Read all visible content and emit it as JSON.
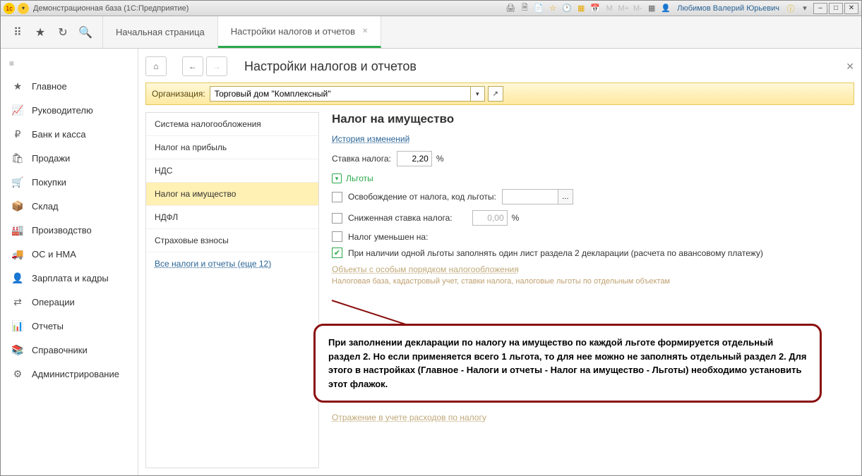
{
  "titlebar": {
    "title": "Демонстрационная база  (1С:Предприятие)",
    "user": "Любимов Валерий Юрьевич",
    "m_buttons": [
      "M",
      "M+",
      "M-"
    ]
  },
  "tabs": {
    "home": "Начальная страница",
    "active": "Настройки налогов и отчетов"
  },
  "sidebar": [
    {
      "icon": "★",
      "label": "Главное"
    },
    {
      "icon": "📈",
      "label": "Руководителю"
    },
    {
      "icon": "₽",
      "label": "Банк и касса"
    },
    {
      "icon": "🛍",
      "label": "Продажи"
    },
    {
      "icon": "🛒",
      "label": "Покупки"
    },
    {
      "icon": "📦",
      "label": "Склад"
    },
    {
      "icon": "🏭",
      "label": "Производство"
    },
    {
      "icon": "🚚",
      "label": "ОС и НМА"
    },
    {
      "icon": "👤",
      "label": "Зарплата и кадры"
    },
    {
      "icon": "⇄",
      "label": "Операции"
    },
    {
      "icon": "📊",
      "label": "Отчеты"
    },
    {
      "icon": "📚",
      "label": "Справочники"
    },
    {
      "icon": "⚙",
      "label": "Администрирование"
    }
  ],
  "page": {
    "title": "Настройки налогов и отчетов",
    "org_label": "Организация:",
    "org_value": "Торговый дом \"Комплексный\""
  },
  "categories": [
    "Система налогообложения",
    "Налог на прибыль",
    "НДС",
    "Налог на имущество",
    "НДФЛ",
    "Страховые взносы"
  ],
  "categories_link": "Все налоги и отчеты (еще 12)",
  "detail": {
    "heading": "Налог на имущество",
    "history_link": "История изменений",
    "rate_label": "Ставка налога:",
    "rate_value": "2,20",
    "rate_unit": "%",
    "benefits_section": "Льготы",
    "exempt_label": "Освобождение от налога, код льготы:",
    "exempt_value": "",
    "reduced_label": "Сниженная ставка налога:",
    "reduced_value": "0,00",
    "reduced_unit": "%",
    "taxreduced_label": "Налог уменьшен на:",
    "single_benefit_label": "При наличии одной льготы заполнять один лист раздела 2 декларации (расчета по авансовому платежу)",
    "objects_link": "Объекты с особым порядком налогообложения",
    "objects_hint": "Налоговая база, кадастровый учет, ставки налога, налоговые льготы по отдельным объектам",
    "expense_link": "Отражение в учете расходов по налогу"
  },
  "callout": "При заполнении декларации по налогу на имущество по каждой льготе формируется отдельный раздел 2. Но если применяется всего 1 льгота, то для нее можно не заполнять отдельный раздел 2. Для этого в настройках (Главное - Налоги и отчеты - Налог на имущество - Льготы) необходимо установить этот флажок."
}
